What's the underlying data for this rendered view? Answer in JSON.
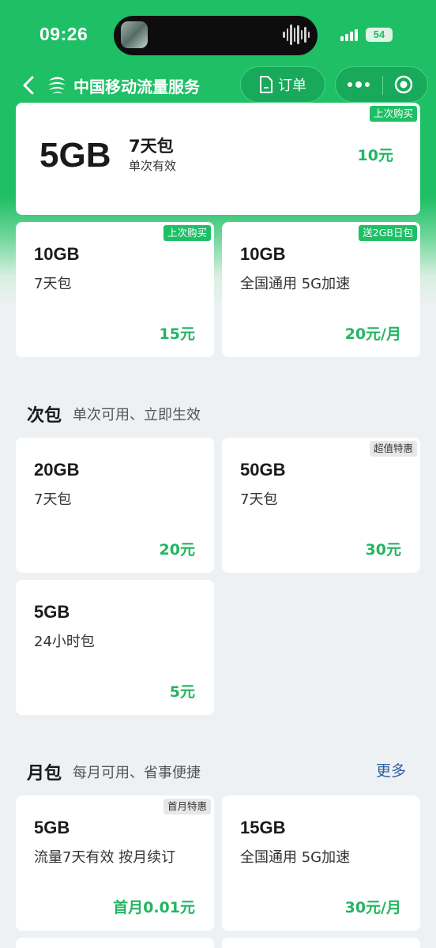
{
  "status_bar": {
    "time": "09:26",
    "battery": "54"
  },
  "nav": {
    "title": "中国移动流量服务",
    "orders_label": "订单"
  },
  "hero": {
    "size": "5GB",
    "name": "7天包",
    "validity": "单次有效",
    "price": "10元",
    "tag": "上次购买"
  },
  "featured": [
    {
      "tag": "上次购买",
      "size": "10GB",
      "desc": "7天包",
      "price": "15元"
    },
    {
      "tag": "送2GB日包",
      "size": "10GB",
      "desc": "全国通用 5G加速",
      "price": "20元/月"
    }
  ],
  "single_section": {
    "title": "次包",
    "subtitle": "单次可用、立即生效",
    "items": [
      {
        "size": "20GB",
        "desc": "7天包",
        "price": "20元"
      },
      {
        "tag": "超值特惠",
        "size": "50GB",
        "desc": "7天包",
        "price": "30元"
      },
      {
        "size": "5GB",
        "desc": "24小时包",
        "price": "5元"
      }
    ]
  },
  "monthly_section": {
    "title": "月包",
    "subtitle": "每月可用、省事便捷",
    "more_label": "更多",
    "items": [
      {
        "tag": "首月特惠",
        "size": "5GB",
        "desc": "流量7天有效 按月续订",
        "price": "首月0.01元"
      },
      {
        "size": "15GB",
        "desc": "全国通用 5G加速",
        "price": "30元/月"
      }
    ]
  },
  "colors": {
    "brand_green": "#1fbf66",
    "price_green": "#22b561",
    "link_blue": "#2f5fa5",
    "page_bg": "#eef1f4"
  }
}
